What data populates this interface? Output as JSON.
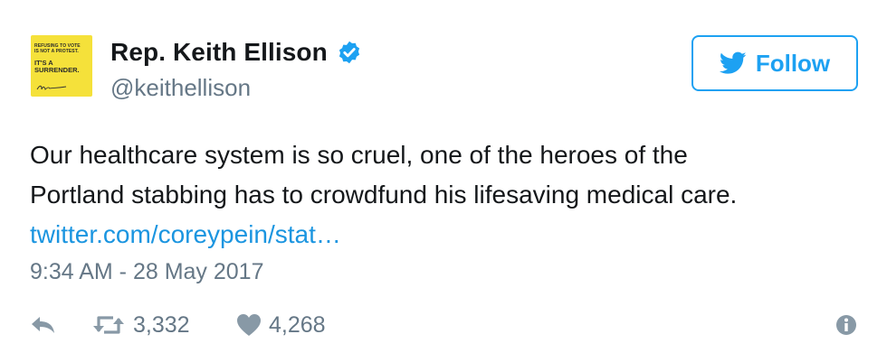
{
  "user": {
    "display_name": "Rep. Keith Ellison",
    "handle": "@keithellison",
    "verified_icon": "verified-badge-icon",
    "avatar": {
      "line1": "REFUSING TO VOTE",
      "line2": "IS NOT A PROTEST.",
      "line3": "IT'S A",
      "line4": "SURRENDER.",
      "background": "#f5e13a"
    }
  },
  "follow_button": {
    "label": "Follow",
    "icon": "twitter-bird-icon",
    "color": "#1da1f2"
  },
  "tweet": {
    "line1": "Our healthcare system is so cruel, one of the heroes of the",
    "line2": "Portland stabbing has to crowdfund his lifesaving medical care.",
    "link": "twitter.com/coreypein/stat…",
    "link_color": "#1b95e0",
    "timestamp": "9:34 AM - 28 May 2017"
  },
  "actions": {
    "reply_icon": "reply-icon",
    "retweet_icon": "retweet-icon",
    "retweet_count": "3,332",
    "like_icon": "heart-icon",
    "like_count": "4,268",
    "info_icon": "info-icon"
  }
}
